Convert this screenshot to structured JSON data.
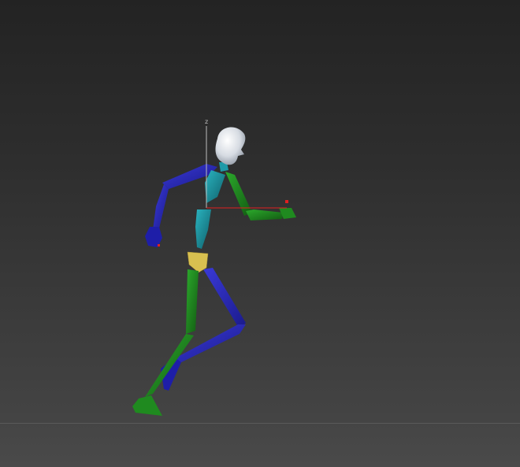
{
  "viewport": {
    "background_top": "#232323",
    "background_bottom": "#474747"
  },
  "gizmo": {
    "z_label": "z",
    "z_color": "#bdbdbd",
    "x_color": "#e02020"
  },
  "biped": {
    "left_side_color": "#2323b8",
    "right_side_color": "#1f8a1f",
    "spine_color": "#1f9aa8",
    "pelvis_color": "#d8c050",
    "head_color": "#dfe4ea"
  }
}
